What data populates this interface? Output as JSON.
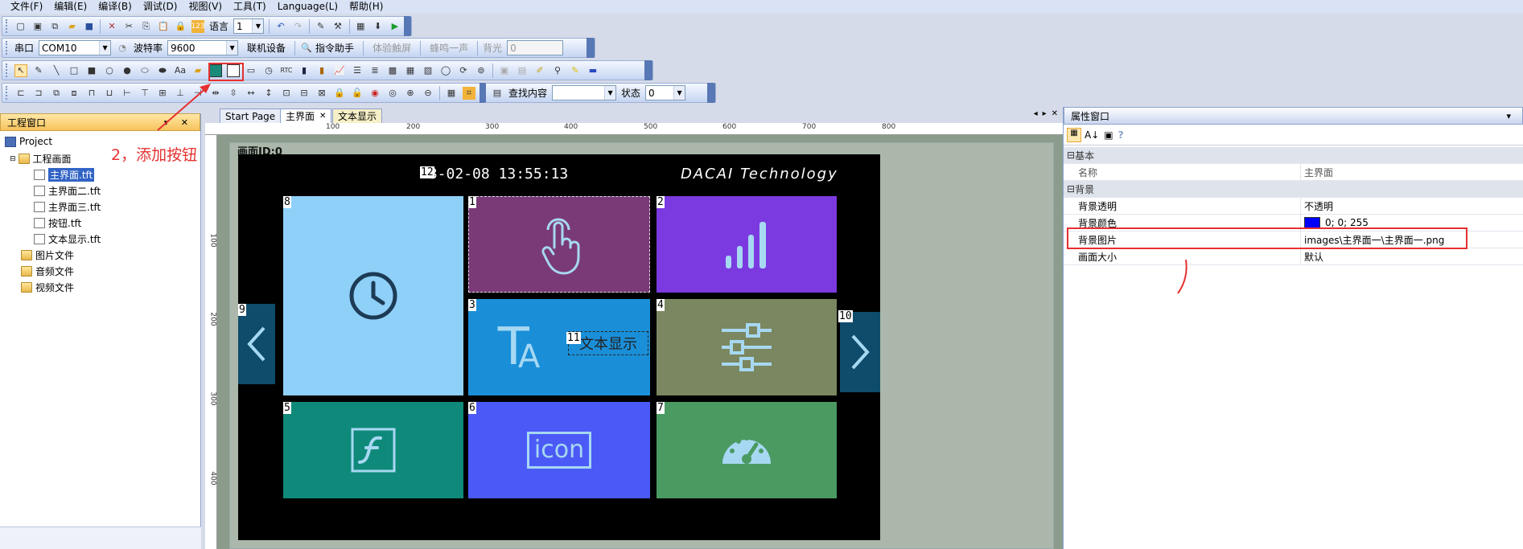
{
  "menu": [
    "文件(F)",
    "编辑(E)",
    "编译(B)",
    "调试(D)",
    "视图(V)",
    "工具(T)",
    "Language(L)",
    "帮助(H)"
  ],
  "toolbar1": {
    "language_label": "语言",
    "language_value": "1"
  },
  "toolbar2": {
    "port_label": "串口",
    "port_value": "COM10",
    "baud_label": "波特率",
    "baud_value": "9600",
    "connect": "联机设备",
    "cmd_helper": "指令助手",
    "touch": "体验触屏",
    "beep": "蜂鸣一声",
    "backlight_label": "背光",
    "backlight_value": "0"
  },
  "toolbar4": {
    "find_label": "查找内容",
    "state_label": "状态",
    "state_value": "0"
  },
  "project_panel": {
    "title": "工程窗口",
    "root": "Project",
    "folder_screens": "工程画面",
    "files": [
      "主界面.tft",
      "主界面二.tft",
      "主界面三.tft",
      "按钮.tft",
      "文本显示.tft"
    ],
    "folders": [
      "图片文件",
      "音频文件",
      "视频文件"
    ]
  },
  "annotation": {
    "text": "2，添加按钮",
    "color": "#e53030"
  },
  "tabs": [
    "Start Page",
    "主界面",
    "文本显示"
  ],
  "ruler_h": [
    "100",
    "200",
    "300",
    "400",
    "500",
    "600",
    "700",
    "800"
  ],
  "ruler_v": [
    "100",
    "200",
    "300",
    "400"
  ],
  "screen": {
    "id_label": "画面ID:0",
    "datetime": "23-02-08 13:55:13",
    "brand": "DACAI Technology",
    "text_control": "文本显示",
    "tile_ids": {
      "t1": "1",
      "t2": "2",
      "t3": "3",
      "t4": "4",
      "t5": "5",
      "t6": "6",
      "t7": "7",
      "t8": "8",
      "t9": "9",
      "t10": "10",
      "t11": "11",
      "t12": "12"
    },
    "icon_text": "icon"
  },
  "colors": {
    "tile1": "#7a3a78",
    "tile2": "#7b3ae0",
    "tile3": "#1a8fd8",
    "tile4": "#7b8760",
    "tile5": "#0f8a7a",
    "tile6": "#4b5af7",
    "tile7": "#4a9a62",
    "tile8": "#8fd0f8",
    "nav": "#0f4c6c"
  },
  "props": {
    "title": "属性窗口",
    "cat_basic": "基本",
    "name_key": "名称",
    "name_val": "主界面",
    "cat_bg": "背景",
    "bg_trans_key": "背景透明",
    "bg_trans_val": "不透明",
    "bg_color_key": "背景颜色",
    "bg_color_val": "0; 0; 255",
    "bg_img_key": "背景图片",
    "bg_img_val": "images\\主界面一\\主界面一.png",
    "size_key": "画面大小",
    "size_val": "默认"
  }
}
